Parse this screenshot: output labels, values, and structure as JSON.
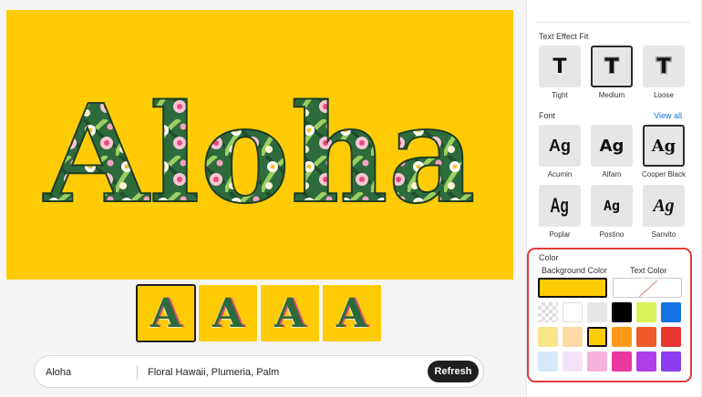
{
  "preview": {
    "headline": "Aloha"
  },
  "thumbnails": [
    {
      "glyph": "A",
      "selected": true
    },
    {
      "glyph": "A",
      "selected": false
    },
    {
      "glyph": "A",
      "selected": false
    },
    {
      "glyph": "A",
      "selected": false
    }
  ],
  "prompt": {
    "text": "Aloha",
    "keywords": "Floral Hawaii, Plumeria, Palm",
    "refresh_label": "Refresh"
  },
  "panel": {
    "fit": {
      "title": "Text Effect Fit",
      "options": [
        {
          "label": "Tight",
          "glyph": "T",
          "selected": false
        },
        {
          "label": "Medium",
          "glyph": "T",
          "selected": true
        },
        {
          "label": "Loose",
          "glyph": "T",
          "selected": false
        }
      ]
    },
    "font": {
      "title": "Font",
      "view_all": "View all",
      "options": [
        {
          "label": "Acumin",
          "glyph": "Ag",
          "selected": false
        },
        {
          "label": "Alfarn",
          "glyph": "Ag",
          "selected": false
        },
        {
          "label": "Cooper Black",
          "glyph": "Ag",
          "selected": true
        },
        {
          "label": "Poplar",
          "glyph": "Ag",
          "selected": false
        },
        {
          "label": "Postino",
          "glyph": "Ag",
          "selected": false
        },
        {
          "label": "Sanvito",
          "glyph": "Ag",
          "selected": false
        }
      ]
    },
    "color": {
      "title": "Color",
      "background_label": "Background Color",
      "text_label": "Text Color",
      "background_value": "#ffcb05",
      "text_value": "none",
      "swatches": [
        "transparent",
        "#ffffff",
        "#e6e6e6",
        "#000000",
        "#d9f25a",
        "#1473e6",
        "#fbe48a",
        "#fcd9a4",
        "#ffcb05",
        "#ff9a1a",
        "#f05a2a",
        "#e8352e",
        "#d7e8fb",
        "#f3e3f8",
        "#f6b3d9",
        "#e9399e",
        "#b03ee8",
        "#8a3ef0"
      ],
      "selected_swatch_index": 8
    }
  },
  "colors": {
    "accent": "#1473e6",
    "highlight_border": "#e03b3b",
    "canvas_bg": "#ffcb05"
  }
}
